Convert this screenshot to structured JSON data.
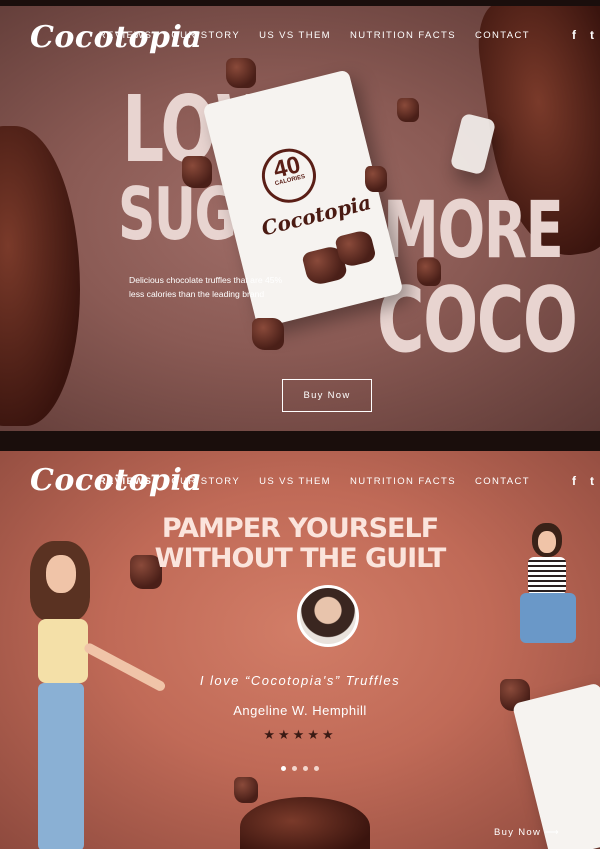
{
  "brand": {
    "logo": "Cocotopia"
  },
  "nav": [
    "REVIEWS",
    "OUR STORY",
    "US VS THEM",
    "NUTRITION FACTS",
    "CONTACT"
  ],
  "social": {
    "facebook": "f",
    "twitter": "t"
  },
  "hero": {
    "word_low": "LOW",
    "word_sugar": "SUGAR",
    "word_more": "MORE",
    "word_coco": "COCO",
    "tagline": "Delicious chocolate truffles that are 45% less calories than the leading brand",
    "cta": "Buy Now",
    "pouch": {
      "calories_number": "40",
      "calories_label": "CALORIES",
      "brand": "Cocotopia"
    }
  },
  "testimonial": {
    "headline_line1": "PAMPER YOURSELF",
    "headline_line2": "WITHOUT THE GUILT",
    "quote": "I love “Cocotopia's” Truffles",
    "author": "Angeline W. Hemphill",
    "rating": 5,
    "rating_stars": "★★★★★",
    "carousel_dots": 4,
    "active_dot": 0,
    "cta": "Buy Now ⟶"
  },
  "colors": {
    "hero_bg": "#8a5a54",
    "testimonial_bg": "#c06a57",
    "headline": "#e8d4d0"
  }
}
